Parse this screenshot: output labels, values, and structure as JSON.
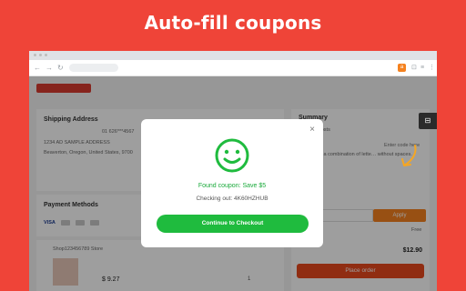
{
  "hero": {
    "title": "Auto-fill coupons"
  },
  "browser": {
    "nav": {
      "back": "←",
      "forward": "→",
      "reload": "↻"
    },
    "extension_icon": "a",
    "toolbar_icons": [
      "⊡",
      "≡",
      "⋮"
    ]
  },
  "page": {
    "shipping": {
      "title": "Shipping Address",
      "phone": "01 626***4567",
      "street": "1234 AD SAMPLE ADDRESS",
      "city": "Beaverton, Oregon, United States, 9700"
    },
    "payment": {
      "title": "Payment Methods",
      "logos": [
        "VISA"
      ]
    },
    "store": {
      "name": "Shop123456789 Store"
    },
    "item": {
      "price": "$ 9.27",
      "qty": "1"
    },
    "summary": {
      "title": "Summary",
      "subtotal_label": "costs",
      "code_hint": "Enter code here",
      "code_note": "is a combination of lette… without spaces.",
      "apply_label": "Apply",
      "shipping_value": "Free",
      "total": "$12.90",
      "place_order": "Place order"
    }
  },
  "modal": {
    "found_text": "Found coupon: Save $5",
    "checking_text": "Checking out: 4K60HZHUB",
    "continue_label": "Continue to Checkout",
    "close_glyph": "×"
  },
  "colors": {
    "brand": "#ef4438",
    "success": "#1fbb3e",
    "accent": "#f5821f"
  }
}
